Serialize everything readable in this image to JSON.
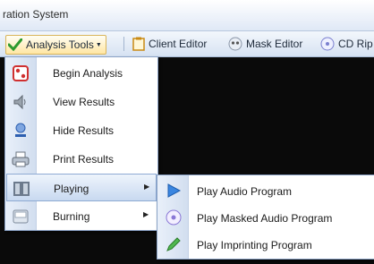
{
  "window": {
    "title": "ration System"
  },
  "toolbar": {
    "analysis_tools": "Analysis Tools",
    "client_editor": "Client Editor",
    "mask_editor": "Mask Editor",
    "cd_rip": "CD Rip"
  },
  "menu": {
    "items": [
      {
        "label": "Begin Analysis",
        "icon": "begin-analysis-icon"
      },
      {
        "label": "View Results",
        "icon": "speaker-icon"
      },
      {
        "label": "Hide Results",
        "icon": "hide-results-icon"
      },
      {
        "label": "Print Results",
        "icon": "printer-icon"
      },
      {
        "label": "Playing",
        "icon": "playing-icon",
        "has_submenu": true,
        "highlighted": true
      },
      {
        "label": "Burning",
        "icon": "burning-icon",
        "has_submenu": true
      }
    ]
  },
  "submenu": {
    "items": [
      {
        "label": "Play Audio Program",
        "icon": "play-icon"
      },
      {
        "label": "Play Masked Audio Program",
        "icon": "masked-disc-icon"
      },
      {
        "label": "Play Imprinting Program",
        "icon": "pen-icon"
      }
    ]
  },
  "colors": {
    "highlight": "#c8d9f0",
    "toolbar_active": "#ffe6a3",
    "background": "#0a0a0a"
  }
}
